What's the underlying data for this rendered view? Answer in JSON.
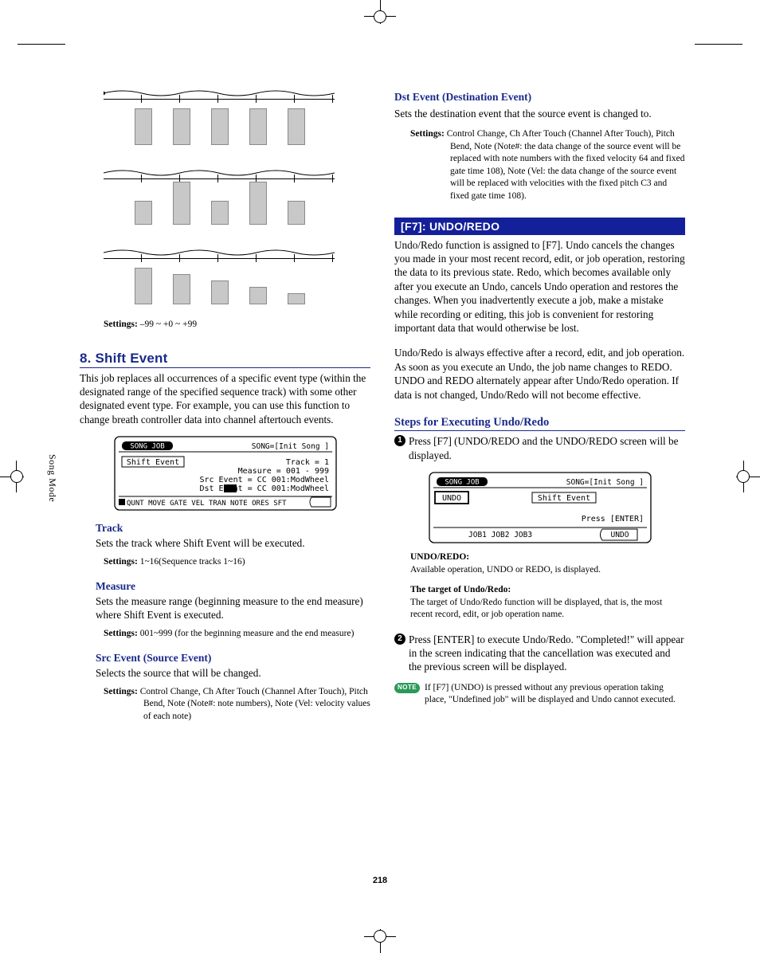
{
  "page_number": "218",
  "side_tab": "Song Mode",
  "left": {
    "diag_settings_label": "Settings:",
    "diag_settings_value": "–99 ~ +0 ~ +99",
    "section_title": "8. Shift Event",
    "section_body": "This job replaces all occurrences of a specific event type (within the designated range of the specified sequence track) with some other designated event type. For example, you can use this function to change breath controller data into channel aftertouch events.",
    "lcd": {
      "header_left": "SONG JOB",
      "header_right": "SONG=[Init Song ]",
      "box": "Shift Event",
      "l1": "Track =  1",
      "l2": "Measure = 001 - 999",
      "l3": "Src Event = CC 001:ModWheel",
      "l4": "Dst Event = CC 001:ModWheel",
      "tabs": "QUNT MOVE GATE VEL TRAN  NOTE ORES SFT"
    },
    "track_h": "Track",
    "track_body": "Sets the track where Shift Event will be executed.",
    "track_settings_label": "Settings:",
    "track_settings_value": "1~16(Sequence tracks 1~16)",
    "measure_h": "Measure",
    "measure_body": "Sets the measure range (beginning measure to the end measure) where Shift Event is executed.",
    "measure_settings_label": "Settings:",
    "measure_settings_value": "001~999 (for the beginning measure and the end measure)",
    "src_h": "Src Event (Source Event)",
    "src_body": "Selects the source that will be changed.",
    "src_settings_label": "Settings:",
    "src_settings_value": "Control Change, Ch After Touch (Channel After Touch), Pitch Bend, Note (Note#: note numbers), Note (Vel: velocity values of each note)"
  },
  "right": {
    "dst_h": "Dst Event (Destination Event)",
    "dst_body": "Sets the destination event that the source event is changed to.",
    "dst_settings_label": "Settings:",
    "dst_settings_value": "Control Change, Ch After Touch (Channel After Touch), Pitch Bend, Note (Note#: the data change of the source event will be replaced with note numbers with the fixed velocity 64 and fixed gate time 108), Note (Vel: the data change of the source event will be replaced with velocities with the fixed pitch C3 and fixed gate time 108).",
    "bar_title": "[F7]: UNDO/REDO",
    "undo_body1": "Undo/Redo function is assigned to [F7]. Undo cancels the changes you made in your most recent record, edit, or job operation, restoring the data to its previous state. Redo, which becomes available only after you execute an Undo, cancels Undo operation and restores the changes. When you inadvertently execute a job, make a mistake while recording or editing, this job is convenient for restoring important data that would otherwise be lost.",
    "undo_body2": "Undo/Redo is always effective after a record, edit, and job operation. As soon as you execute an Undo, the job name changes to REDO. UNDO and REDO alternately appear after Undo/Redo operation. If data is not changed, Undo/Redo will not become effective.",
    "steps_h": "Steps for Executing Undo/Redo",
    "step1": "Press [F7] (UNDO/REDO and the UNDO/REDO screen will be displayed.",
    "lcd": {
      "header_left": "SONG JOB",
      "header_right": "SONG=[Init Song ]",
      "undo": "UNDO",
      "target": "Shift Event",
      "press": "Press [ENTER]",
      "tabs": "JOB1 JOB2 JOB3          UNDO"
    },
    "nb1_title": "UNDO/REDO:",
    "nb1_body": "Available operation, UNDO or REDO, is displayed.",
    "nb2_title": "The target of Undo/Redo:",
    "nb2_body": "The target of Undo/Redo function will be displayed, that is, the most recent record, edit, or job operation name.",
    "step2": "Press [ENTER] to execute Undo/Redo. \"Completed!\" will appear in the screen indicating that the cancellation was executed and the previous screen will be displayed.",
    "note_badge": "NOTE",
    "note_body": "If [F7] (UNDO) is pressed without any previous operation taking place, \"Undefined job\" will be displayed and Undo cannot executed."
  }
}
